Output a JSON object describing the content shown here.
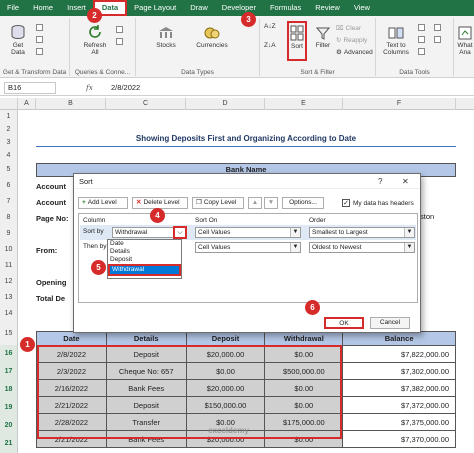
{
  "ribbon": {
    "tabs": [
      "File",
      "Home",
      "Insert",
      "Data",
      "Page Layout",
      "Draw",
      "Developer",
      "Formulas",
      "Review",
      "View"
    ],
    "active_tab": "Data",
    "get_data": "Get",
    "get_data2": "Data",
    "refresh": "Refresh",
    "refresh2": "All",
    "stocks": "Stocks",
    "currencies": "Currencies",
    "sort_az": "A↓Z",
    "sort_za": "Z↓A",
    "sort": "Sort",
    "filter": "Filter",
    "clear": "Clear",
    "reapply": "Reapply",
    "advanced": "Advanced",
    "text_to_columns": "Text to",
    "text_to_columns2": "Columns",
    "what_if": "What",
    "what_if2": "Ana",
    "group_get_transform": "Get & Transform Data",
    "group_queries": "Queries & Conne...",
    "group_data_types": "Data Types",
    "group_sort_filter": "Sort & Filter",
    "group_data_tools": "Data Tools"
  },
  "formula_bar": {
    "name_box": "B16",
    "fx": "fx",
    "value": "2/8/2022"
  },
  "columns": [
    "A",
    "B",
    "C",
    "D",
    "E",
    "F"
  ],
  "rows": [
    "1",
    "2",
    "3",
    "4",
    "5",
    "6",
    "7",
    "8",
    "9",
    "10",
    "11",
    "12",
    "13",
    "14",
    "15",
    "16",
    "17",
    "18",
    "19",
    "20",
    "21"
  ],
  "sheet": {
    "title": "Showing Deposits First and Organizing According to Date",
    "bank_header": "Bank Name",
    "labels": [
      "Account",
      "Account",
      "Page No:",
      "From:",
      "Opening",
      "Total De"
    ],
    "ghost_text": "ston",
    "headers": [
      "Date",
      "Details",
      "Deposit",
      "Withdrawal",
      "Balance"
    ],
    "data": [
      [
        "2/8/2022",
        "Deposit",
        "$20,000.00",
        "$0.00",
        "$7,822,000.00"
      ],
      [
        "2/3/2022",
        "Cheque No: 657",
        "$0.00",
        "$500,000.00",
        "$7,302,000.00"
      ],
      [
        "2/16/2022",
        "Bank Fees",
        "$20,000.00",
        "$0.00",
        "$7,382,000.00"
      ],
      [
        "2/21/2022",
        "Deposit",
        "$150,000.00",
        "$0.00",
        "$7,372,000.00"
      ],
      [
        "2/28/2022",
        "Transfer",
        "$0.00",
        "$175,000.00",
        "$7,375,000.00"
      ],
      [
        "2/21/2022",
        "Bank Fees",
        "$20,000.00",
        "$0.00",
        "$7,370,000.00"
      ]
    ],
    "watermark": "exceldemy"
  },
  "dialog": {
    "title": "Sort",
    "help": "?",
    "close": "✕",
    "add_level": "Add Level",
    "delete_level": "Delete Level",
    "copy_level": "Copy Level",
    "options": "Options...",
    "my_data_has_headers": "My data has headers",
    "col_header": "Column",
    "sort_on_header": "Sort On",
    "order_header": "Order",
    "sort_by": "Sort by",
    "then_by": "Then by",
    "sort_by_value": "Withdrawal",
    "sort_on_1": "Cell Values",
    "sort_on_2": "Cell Values",
    "order_1": "Smallest to Largest",
    "order_2": "Oldest to Newest",
    "dropdown_options": [
      "Date",
      "Details",
      "Deposit",
      "Withdrawal"
    ],
    "ok": "OK",
    "cancel": "Cancel"
  },
  "steps": [
    "1",
    "2",
    "3",
    "4",
    "5",
    "6"
  ],
  "colors": {
    "excel_green": "#217346",
    "highlight_red": "#d62b2b",
    "header_blue": "#b4c7e7"
  }
}
